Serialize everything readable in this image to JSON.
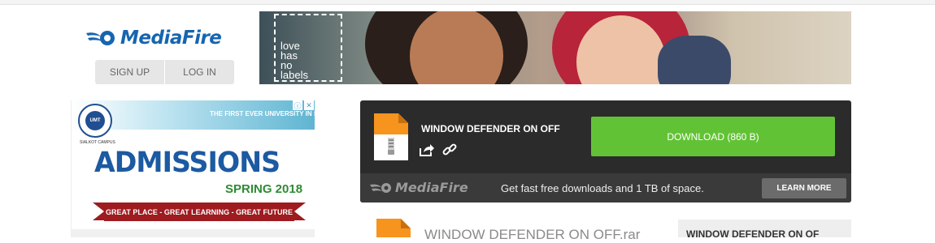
{
  "header": {
    "logo_text": "MediaFire",
    "sign_up": "SIGN UP",
    "log_in": "LOG IN"
  },
  "banner": {
    "caption_lines": [
      "love",
      "has",
      "no",
      "labels"
    ]
  },
  "ad": {
    "seal_text": "UMT",
    "campus": "SIALKOT CAMPUS",
    "tagline": "THE FIRST EVER UNIVERSITY IN SIALKOT",
    "headline": "ADMISSIONS",
    "term": "SPRING 2018",
    "ribbon": "GREAT PLACE - GREAT LEARNING - GREAT FUTURE",
    "adchoices_icon": "info-icon",
    "close_icon": "close-icon"
  },
  "download": {
    "file_name": "WINDOW DEFENDER ON OFF",
    "button_label": "DOWNLOAD (860 B)",
    "button_color": "#62c235",
    "promo_logo": "MediaFire",
    "promo_text": "Get fast free downloads and 1 TB of space.",
    "learn_more": "LEARN MORE"
  },
  "details": {
    "file_full_name": "WINDOW DEFENDER ON OFF.rar",
    "side_title": "WINDOW DEFENDER ON OF"
  },
  "colors": {
    "brand_blue": "#1665b0",
    "card_bg": "#2b2b2b",
    "file_orange": "#f7941e"
  }
}
